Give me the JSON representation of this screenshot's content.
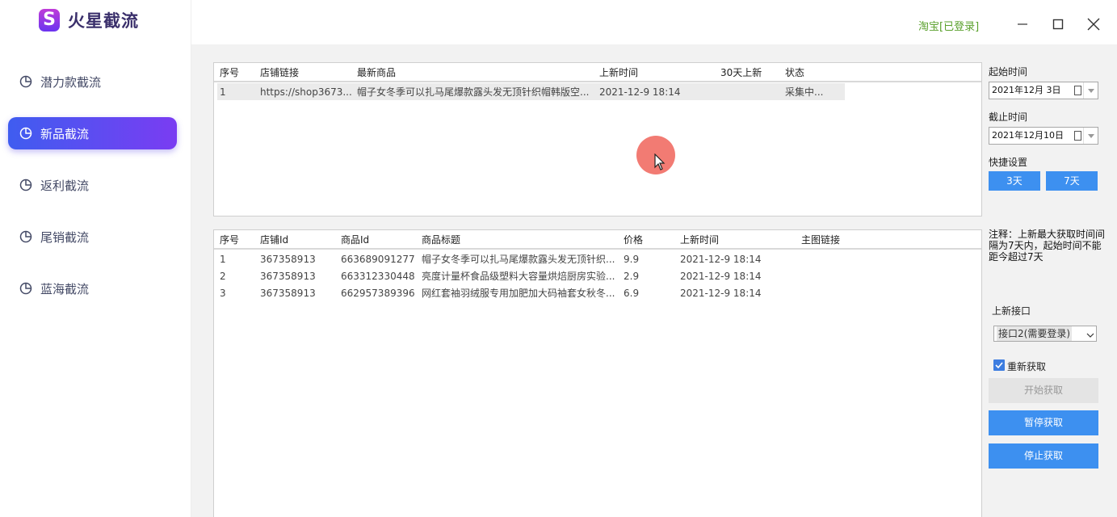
{
  "app": {
    "logo_letter": "S",
    "name": "火星截流",
    "accent_color": "#5a4af0",
    "login_status": "淘宝[已登录]"
  },
  "sidebar": {
    "items": [
      {
        "label": "潜力款截流",
        "icon": "pie-chart-icon",
        "active": false
      },
      {
        "label": "新品截流",
        "icon": "pie-chart-icon",
        "active": true
      },
      {
        "label": "返利截流",
        "icon": "pie-chart-icon",
        "active": false
      },
      {
        "label": "尾销截流",
        "icon": "pie-chart-icon",
        "active": false
      },
      {
        "label": "蓝海截流",
        "icon": "pie-chart-icon",
        "active": false
      }
    ]
  },
  "window": {
    "minimize": "minimize-icon",
    "maximize": "maximize-icon",
    "close": "close-icon"
  },
  "shop_table": {
    "headers": [
      "序号",
      "店铺链接",
      "最新商品",
      "上新时间",
      "30天上新",
      "状态"
    ],
    "rows": [
      [
        "1",
        "https://shop3673...",
        "帽子女冬季可以扎马尾爆款露头发无顶针织帽韩版空...",
        "2021-12-9 18:14",
        "",
        "采集中..."
      ]
    ]
  },
  "product_table": {
    "headers": [
      "序号",
      "店铺Id",
      "商品Id",
      "商品标题",
      "价格",
      "上新时间",
      "主图链接"
    ],
    "rows": [
      [
        "1",
        "367358913",
        "663689091277",
        "帽子女冬季可以扎马尾爆款露头发无顶针织...",
        "9.9",
        "2021-12-9 18:14",
        ""
      ],
      [
        "2",
        "367358913",
        "663312330448",
        "亮度计量杯食品级塑料大容量烘焙厨房实验...",
        "2.9",
        "2021-12-9 18:14",
        ""
      ],
      [
        "3",
        "367358913",
        "662957389396",
        "网红套袖羽绒服专用加肥加大码袖套女秋冬...",
        "6.9",
        "2021-12-9 18:14",
        ""
      ]
    ]
  },
  "settings": {
    "start_label": "起始时间",
    "start_value": "2021年12月  3日",
    "end_label": "截止时间",
    "end_value": "2021年12月10日",
    "quick_label": "快捷设置",
    "quick_3": "3天",
    "quick_7": "7天",
    "note": "注释：上新最大获取时间间隔为7天内，起始时间不能距今超过7天",
    "api_label": "上新接口",
    "api_value": "接口2(需要登录)",
    "refetch_label": "重新获取",
    "refetch_checked": true,
    "start_btn": "开始获取",
    "pause_btn": "暂停获取",
    "stop_btn": "停止获取"
  }
}
